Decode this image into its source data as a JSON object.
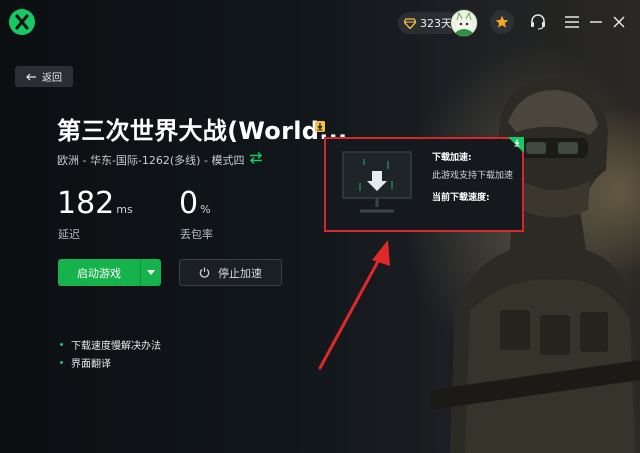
{
  "header": {
    "days_text": "323天"
  },
  "nav": {
    "back_label": "返回"
  },
  "game": {
    "title": "第三次世界大战(World...",
    "server": "欧洲 - 华东-国际-1262(多线) - 模式四"
  },
  "stats": {
    "latency_value": "182",
    "latency_unit": "ms",
    "latency_label": "延迟",
    "loss_value": "0",
    "loss_unit": "%",
    "loss_label": "丢包率"
  },
  "actions": {
    "launch_label": "启动游戏",
    "stop_label": "停止加速"
  },
  "links": {
    "items": [
      "下载速度慢解决办法",
      "界面翻译"
    ]
  },
  "popup": {
    "title": "下载加速:",
    "description": "此游戏支持下载加速",
    "speed_label": "当前下载速度:"
  },
  "colors": {
    "accent": "#16b24c",
    "highlight_border": "#d4282a",
    "background": "#0d1013"
  }
}
